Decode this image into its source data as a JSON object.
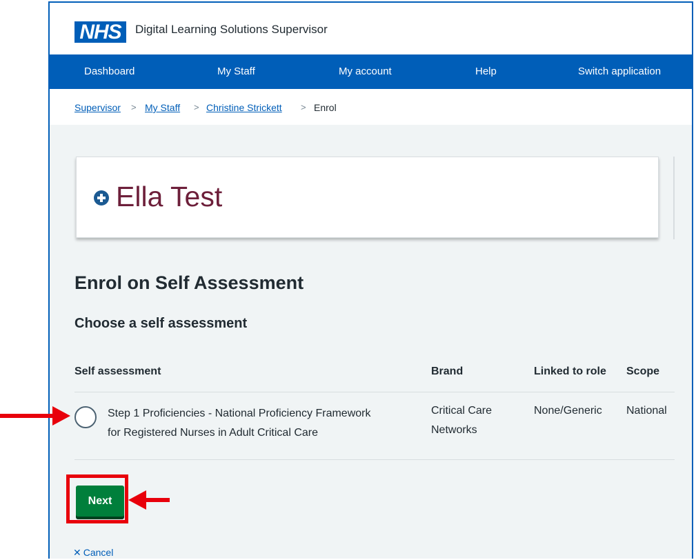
{
  "header": {
    "logo_text": "NHS",
    "app_title": "Digital Learning Solutions Supervisor"
  },
  "nav": {
    "items": [
      "Dashboard",
      "My Staff",
      "My account",
      "Help",
      "Switch application"
    ]
  },
  "breadcrumb": {
    "items": [
      "Supervisor",
      "My Staff",
      "Christine Strickett",
      "Enrol"
    ],
    "separator": ">"
  },
  "banner": {
    "brand_name": "Ella Test",
    "icon": "plus-circle-icon"
  },
  "page": {
    "title": "Enrol on Self Assessment",
    "subtitle": "Choose a self assessment"
  },
  "table": {
    "headers": [
      "Self assessment",
      "Brand",
      "Linked to role",
      "Scope"
    ],
    "rows": [
      {
        "name_line1": "Step 1 Proficiencies - National Proficiency Framework",
        "name_line2": "for Registered Nurses in Adult Critical Care",
        "brand_line1": "Critical Care",
        "brand_line2": "Networks",
        "linked_to_role": "None/Generic",
        "scope": "National",
        "selected": false
      }
    ]
  },
  "actions": {
    "next_label": "Next",
    "cancel_label": "Cancel",
    "cancel_icon": "close-icon"
  },
  "colors": {
    "nhs_blue": "#005eb8",
    "primary_button": "#007f3b",
    "annotation_red": "#e8000b",
    "brand_text": "#6d1f3a",
    "page_background": "#f0f4f5"
  }
}
